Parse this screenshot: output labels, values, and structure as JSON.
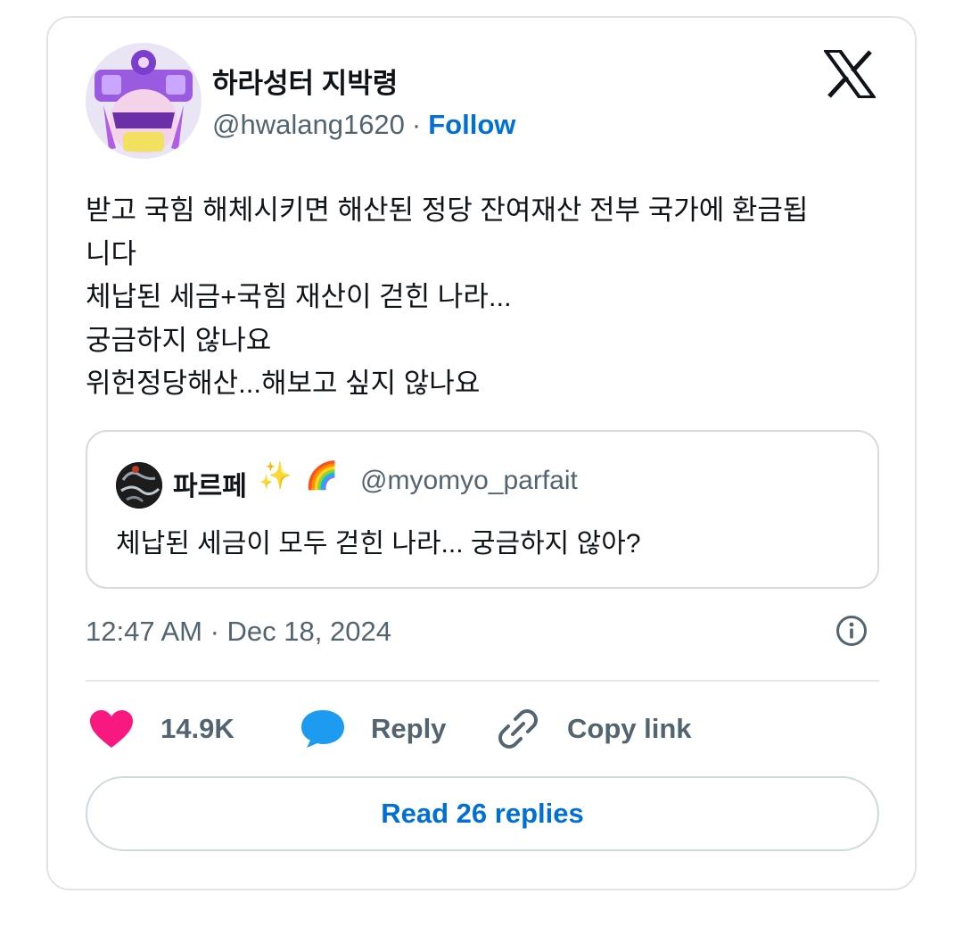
{
  "tweet": {
    "author": {
      "name": "하라성터 지박령",
      "handle": "@hwalang1620",
      "separator": "·",
      "follow_label": "Follow"
    },
    "text_lines": [
      "받고 국힘 해체시키면 해산된 정당 잔여재산 전부 국가에 환금됩",
      "니다",
      "체납된 세금+국힘 재산이 걷힌 나라...",
      "궁금하지 않나요",
      "위헌정당해산...해보고 싶지 않나요"
    ],
    "quote": {
      "name": "파르페",
      "emojis": [
        "✨",
        "🌈"
      ],
      "handle": "@myomyo_parfait",
      "text": "체납된 세금이 모두 걷힌 나라... 궁금하지 않아?"
    },
    "timestamp": "12:47 AM · Dec 18, 2024",
    "actions": {
      "like_count": "14.9K",
      "reply_label": "Reply",
      "copy_label": "Copy link"
    },
    "read_replies_label": "Read 26 replies"
  },
  "icons": [
    "x-logo-icon",
    "info-icon",
    "heart-icon",
    "reply-bubble-icon",
    "link-icon"
  ],
  "colors": {
    "follow": "#006fd6",
    "like": "#f91880",
    "reply": "#1d9bf0",
    "secondary_text": "#536471",
    "border": "#dfe3e7"
  }
}
